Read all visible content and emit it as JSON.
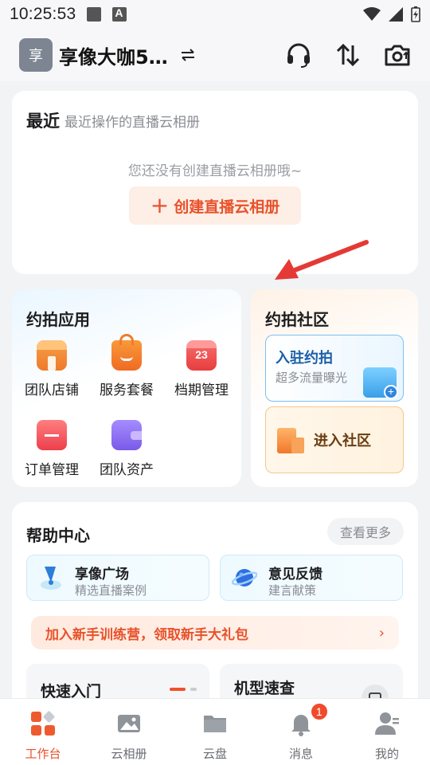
{
  "status_bar": {
    "time": "10:25:53"
  },
  "header": {
    "avatar_char": "享",
    "team_name": "享像大咖5…",
    "actions": [
      "headset-icon",
      "sort-icon",
      "camera-upload-icon"
    ]
  },
  "recent": {
    "title": "最近",
    "subtitle": "最近操作的直播云相册",
    "empty_text": "您还没有创建直播云相册哦~",
    "create_label": "创建直播云相册",
    "create_plus": "+"
  },
  "apps": {
    "title": "约拍应用",
    "items": [
      {
        "label": "团队店铺",
        "icon": "store-icon",
        "color": "#f08a3c"
      },
      {
        "label": "服务套餐",
        "icon": "shopping-bag-icon",
        "color": "#f07a2c"
      },
      {
        "label": "档期管理",
        "icon": "calendar-icon",
        "color": "#ef4b4b",
        "icon_text": "23"
      },
      {
        "label": "订单管理",
        "icon": "order-icon",
        "color": "#f0505a"
      },
      {
        "label": "团队资产",
        "icon": "wallet-icon",
        "color": "#8a6cf0"
      }
    ]
  },
  "community": {
    "title": "约拍社区",
    "join_title": "入驻约拍",
    "join_subtitle": "超多流量曝光",
    "enter_label": "进入社区"
  },
  "help": {
    "title": "帮助中心",
    "see_more": "查看更多",
    "tiles": [
      {
        "title": "享像广场",
        "subtitle": "精选直播案例",
        "icon": "pin-icon"
      },
      {
        "title": "意见反馈",
        "subtitle": "建言献策",
        "icon": "planet-icon"
      }
    ],
    "banner": "加入新手训练营，领取新手大礼包",
    "quick": [
      "快速入门",
      "机型速查"
    ]
  },
  "tabs": [
    {
      "label": "工作台",
      "icon": "workbench-icon",
      "active": true
    },
    {
      "label": "云相册",
      "icon": "album-icon"
    },
    {
      "label": "云盘",
      "icon": "folder-icon"
    },
    {
      "label": "消息",
      "icon": "bell-icon",
      "badge": "1"
    },
    {
      "label": "我的",
      "icon": "profile-icon"
    }
  ],
  "colors": {
    "accent": "#e8522b",
    "background": "#f2f3f5"
  }
}
